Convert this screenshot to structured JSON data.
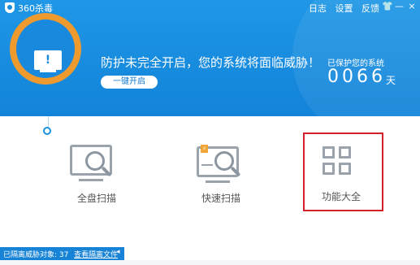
{
  "window": {
    "title": "360杀毒",
    "menu": [
      "日志",
      "设置",
      "反馈"
    ],
    "controls": {
      "skin": "👕",
      "minimize": "—",
      "close": "×"
    }
  },
  "banner": {
    "warning": "防护未完全开启，您的系统将面临威胁！",
    "fix_button": "一键开启",
    "protected_label": "已保护您的系统",
    "protected_days": "0066",
    "days_unit": "天"
  },
  "features": [
    {
      "label": "全盘扫描",
      "icon": "full-scan-icon"
    },
    {
      "label": "快速扫描",
      "icon": "quick-scan-icon"
    },
    {
      "label": "功能大全",
      "icon": "all-features-grid-icon"
    }
  ],
  "quarantine": {
    "status": "已隔离威胁对象: 37",
    "link": "查看隔离文件",
    "arrow": "◂"
  },
  "colors": {
    "header_blue": "#1a8fe0",
    "ring_orange": "#ef9a2f",
    "highlight_red": "#d3202a"
  }
}
